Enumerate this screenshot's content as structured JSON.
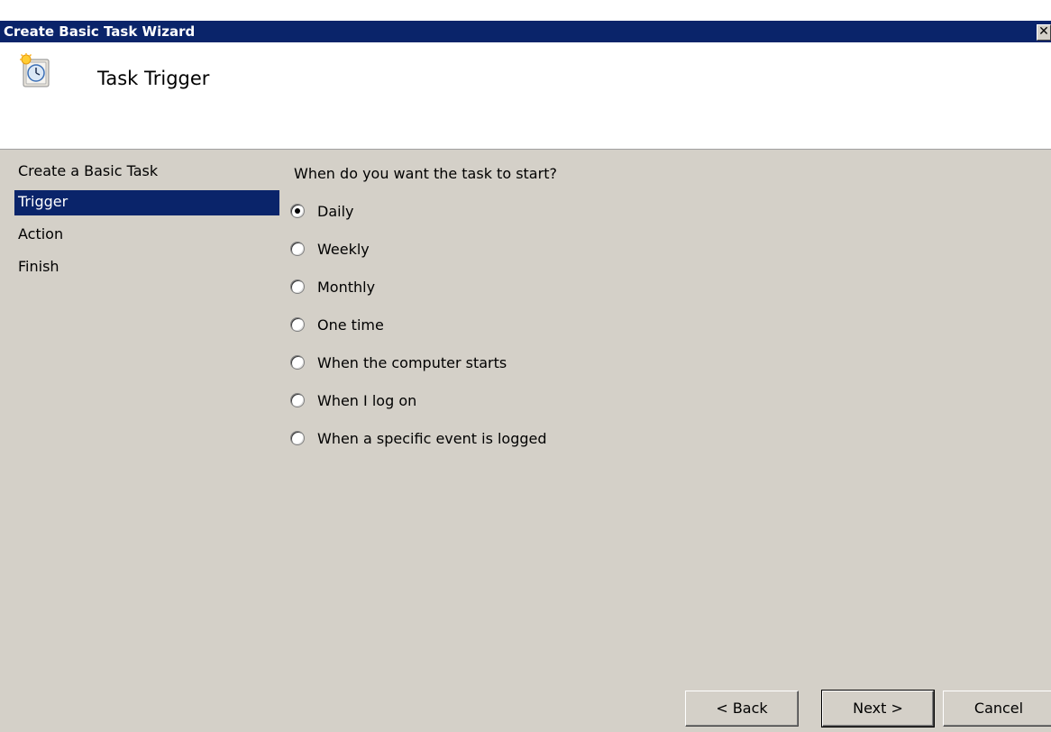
{
  "window": {
    "title": "Create Basic Task Wizard",
    "close_glyph": "✕"
  },
  "header": {
    "title": "Task Trigger",
    "icon": "task-clock-icon"
  },
  "steps": [
    {
      "label": "Create a Basic Task"
    },
    {
      "label": "Trigger",
      "selected": true
    },
    {
      "label": "Action"
    },
    {
      "label": "Finish"
    }
  ],
  "question": "When do you want the task to start?",
  "options": [
    {
      "label": "Daily",
      "checked": true
    },
    {
      "label": "Weekly",
      "checked": false
    },
    {
      "label": "Monthly",
      "checked": false
    },
    {
      "label": "One time",
      "checked": false
    },
    {
      "label": "When the computer starts",
      "checked": false
    },
    {
      "label": "When I log on",
      "checked": false
    },
    {
      "label": "When a specific event is logged",
      "checked": false
    }
  ],
  "buttons": {
    "back": "< Back",
    "next": "Next >",
    "cancel": "Cancel"
  },
  "colors": {
    "titlebar": "#0a246a",
    "dialog_bg": "#d4d0c8",
    "selection": "#0a246a"
  }
}
